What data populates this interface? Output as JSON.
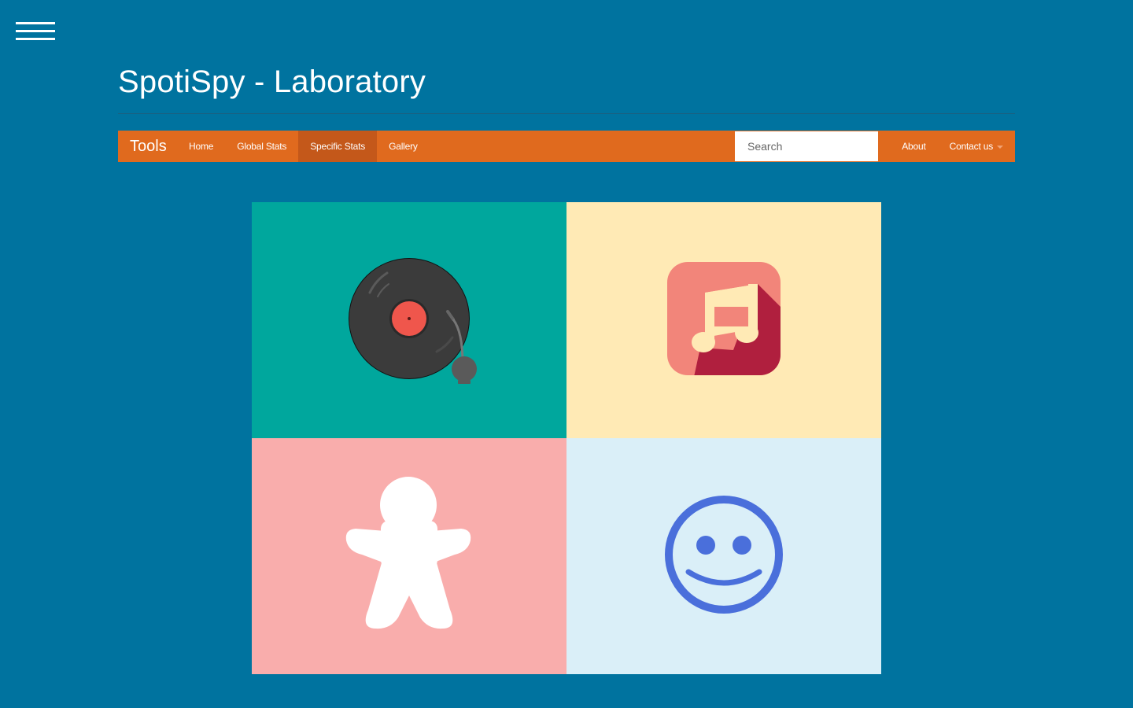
{
  "site": {
    "title": "SpotiSpy - Laboratory"
  },
  "navbar": {
    "brand": "Tools",
    "left_items": [
      {
        "label": "Home",
        "active": false
      },
      {
        "label": "Global Stats",
        "active": false
      },
      {
        "label": "Specific Stats",
        "active": true
      },
      {
        "label": "Gallery",
        "active": false
      }
    ],
    "search": {
      "placeholder": "Search",
      "value": ""
    },
    "right_items": [
      {
        "label": "About"
      },
      {
        "label": "Contact us",
        "has_dropdown": true
      }
    ]
  },
  "tiles": [
    {
      "icon": "vinyl-turntable-icon",
      "background": "#00a79d"
    },
    {
      "icon": "music-note-icon",
      "background": "#ffeab5"
    },
    {
      "icon": "gingerbread-man-icon",
      "background": "#f9adac"
    },
    {
      "icon": "smiley-face-icon",
      "background": "#daeff8"
    }
  ],
  "colors": {
    "page_background": "#00739f",
    "navbar": "#e06a1e",
    "navbar_active": "#c4581a"
  }
}
